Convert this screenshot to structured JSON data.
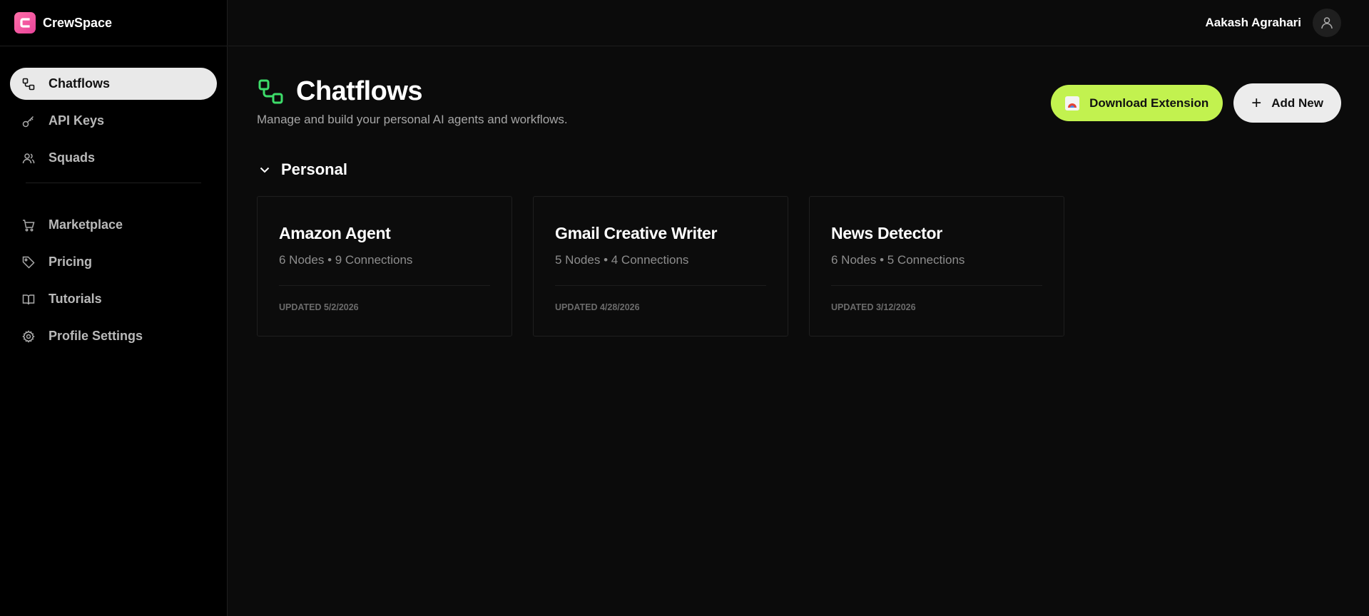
{
  "brand": {
    "name": "CrewSpace",
    "logo_color": "#e8439a"
  },
  "user": {
    "name": "Aakash Agrahari"
  },
  "sidebar": {
    "items": [
      {
        "label": "Chatflows",
        "icon": "chatflows-icon",
        "active": true
      },
      {
        "label": "API Keys",
        "icon": "key-icon"
      },
      {
        "label": "Squads",
        "icon": "users-icon"
      },
      {
        "label": "Marketplace",
        "icon": "cart-icon"
      },
      {
        "label": "Pricing",
        "icon": "tag-icon"
      },
      {
        "label": "Tutorials",
        "icon": "book-icon"
      },
      {
        "label": "Profile Settings",
        "icon": "gear-icon"
      }
    ]
  },
  "page": {
    "title": "Chatflows",
    "subtitle": "Manage and build your personal AI agents and workflows.",
    "accent": "#3ddc6a"
  },
  "actions": {
    "download_label": "Download Extension",
    "add_label": "Add New",
    "download_color": "#c2f24f"
  },
  "section": {
    "title": "Personal"
  },
  "cards": [
    {
      "title": "Amazon Agent",
      "nodes": "6 Nodes",
      "connections": "9 Connections",
      "updated": "UPDATED 5/2/2026"
    },
    {
      "title": "Gmail Creative Writer",
      "nodes": "5 Nodes",
      "connections": "4 Connections",
      "updated": "UPDATED 4/28/2026"
    },
    {
      "title": "News Detector",
      "nodes": "6 Nodes",
      "connections": "5 Connections",
      "updated": "UPDATED 3/12/2026"
    }
  ]
}
